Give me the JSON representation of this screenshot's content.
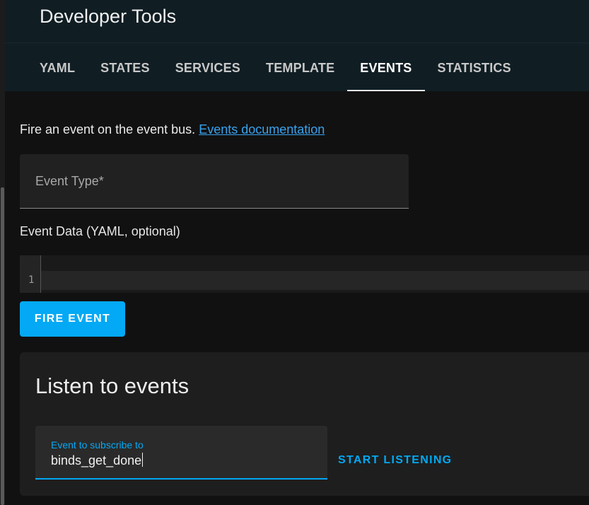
{
  "header": {
    "title": "Developer Tools",
    "tabs": [
      {
        "label": "YAML"
      },
      {
        "label": "STATES"
      },
      {
        "label": "SERVICES"
      },
      {
        "label": "TEMPLATE"
      },
      {
        "label": "EVENTS",
        "active": true
      },
      {
        "label": "STATISTICS"
      }
    ]
  },
  "fire": {
    "intro_text": "Fire an event on the event bus.",
    "doc_link": "Events documentation",
    "event_type_label": "Event Type*",
    "event_data_label": "Event Data (YAML, optional)",
    "editor_line_number": "1",
    "button_label": "FIRE EVENT"
  },
  "listen": {
    "title": "Listen to events",
    "field_label": "Event to subscribe to",
    "field_value": "binds_get_done",
    "button_label": "START LISTENING"
  },
  "colors": {
    "accent": "#03a9f4",
    "header_bg": "#101e24",
    "link": "#38a3ee",
    "page_bg": "#111111"
  }
}
